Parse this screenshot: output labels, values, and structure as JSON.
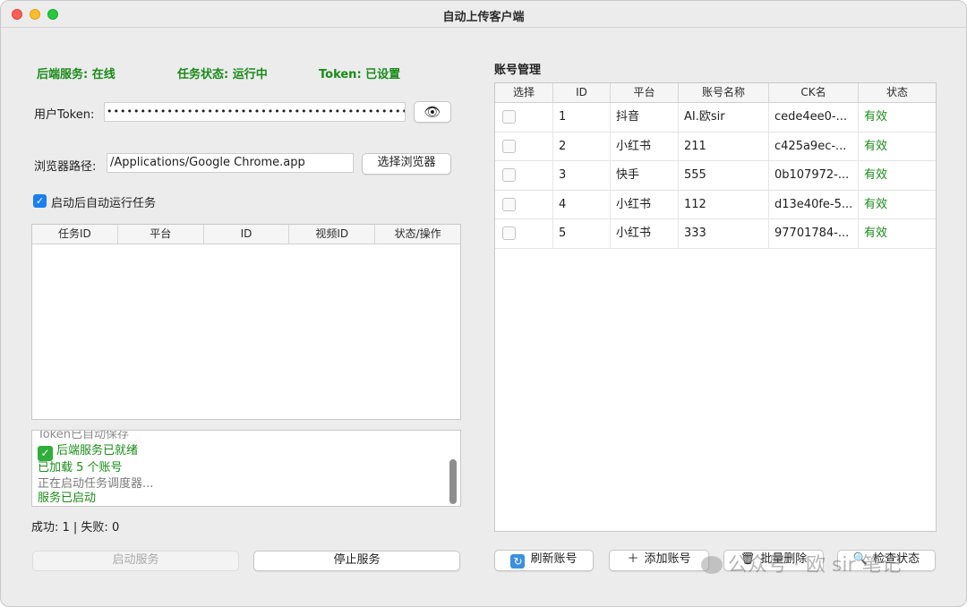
{
  "window": {
    "title": "自动上传客户端"
  },
  "status": {
    "backend": "后端服务: 在线",
    "task": "任务状态: 运行中",
    "token": "Token: 已设置"
  },
  "token": {
    "label": "用户Token:",
    "value": "•••••••••••••••••••••••••••••••••••••••••••••••••••",
    "toggle_icon": "👁"
  },
  "browser": {
    "label": "浏览器路径:",
    "value": "/Applications/Google Chrome.app",
    "button": "选择浏览器"
  },
  "auto_run": {
    "label": "启动后自动运行任务",
    "checked": true
  },
  "task_table": {
    "columns": [
      "任务ID",
      "平台",
      "ID",
      "视频ID",
      "状态/操作"
    ]
  },
  "log": {
    "lines": [
      "Token已自动保存",
      "后端服务已就绪",
      "已加载 5 个账号",
      "正在启动任务调度器...",
      "服务已启动"
    ]
  },
  "counts": "成功: 1 | 失败: 0",
  "buttons": {
    "start": "启动服务",
    "stop": "停止服务"
  },
  "accounts": {
    "title": "账号管理",
    "columns": [
      "选择",
      "ID",
      "平台",
      "账号名称",
      "CK名",
      "状态"
    ],
    "rows": [
      {
        "id": "1",
        "platform": "抖音",
        "name": "AI.欧sir",
        "ck": "cede4ee0-...",
        "status": "有效"
      },
      {
        "id": "2",
        "platform": "小红书",
        "name": "211",
        "ck": "c425a9ec-...",
        "status": "有效"
      },
      {
        "id": "3",
        "platform": "快手",
        "name": "555",
        "ck": "0b107972-...",
        "status": "有效"
      },
      {
        "id": "4",
        "platform": "小红书",
        "name": "112",
        "ck": "d13e40fe-5...",
        "status": "有效"
      },
      {
        "id": "5",
        "platform": "小红书",
        "name": "333",
        "ck": "97701784-...",
        "status": "有效"
      }
    ]
  },
  "account_buttons": {
    "refresh": "刷新账号",
    "add": "添加账号",
    "batch_delete": "批量删除",
    "check_status": "检查状态"
  },
  "watermark": "公众号 · 欧 sir 笔记",
  "colors": {
    "status_green": "#1a8a1a",
    "accent": "#1a7ff0"
  }
}
